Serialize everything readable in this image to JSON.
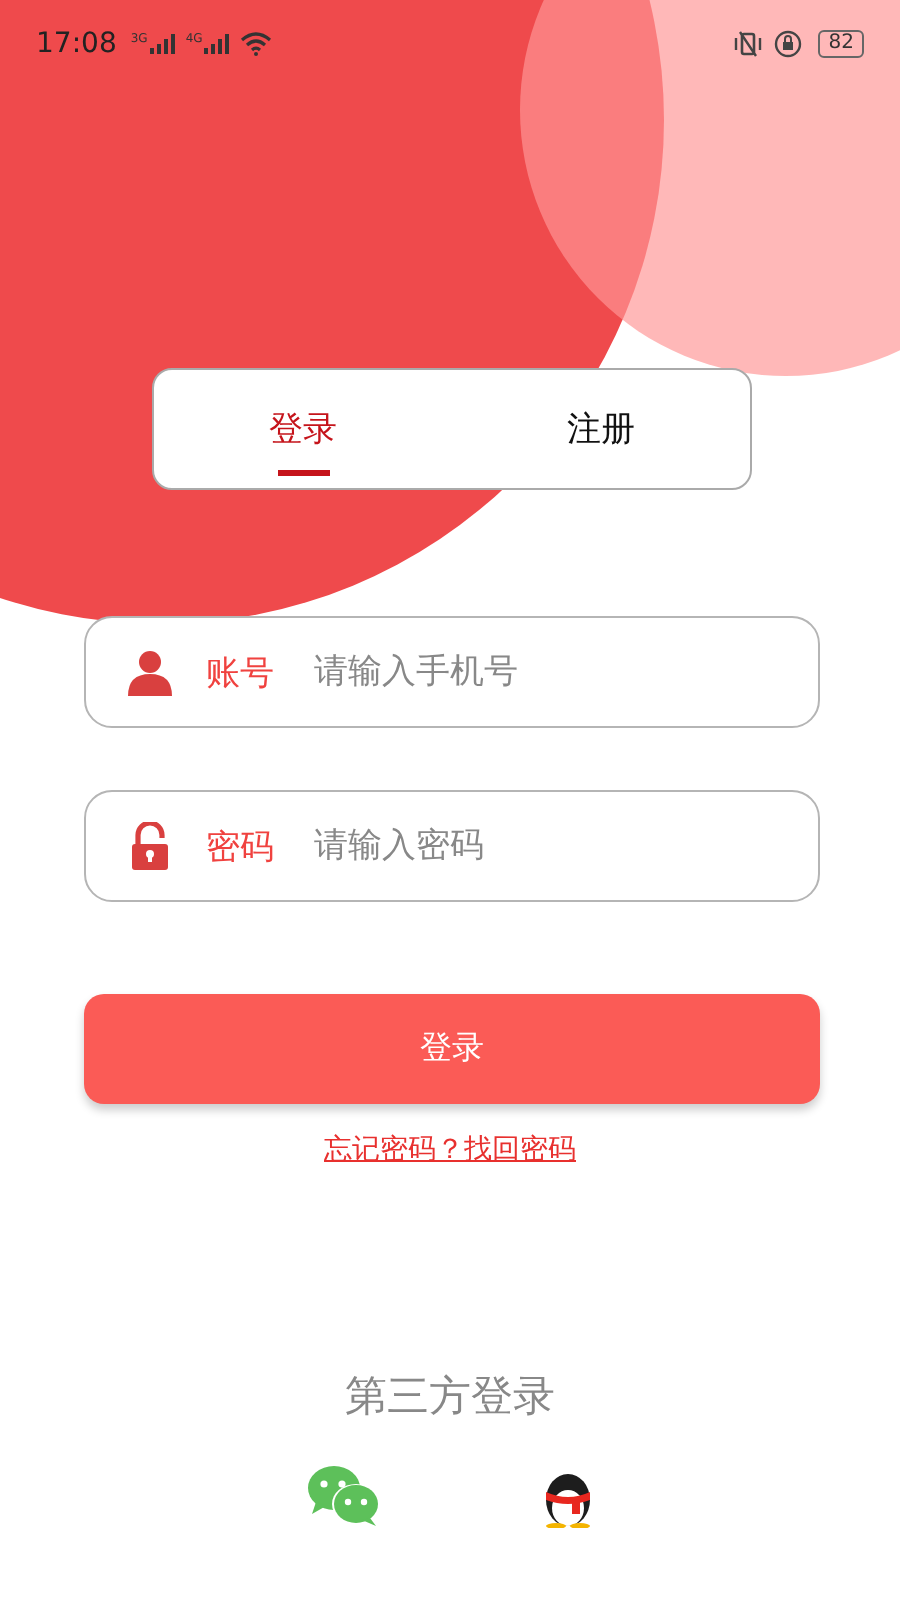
{
  "status_bar": {
    "time": "17:08",
    "network_labels": [
      "3G",
      "4G"
    ],
    "battery": "82"
  },
  "tabs": [
    {
      "label": "登录",
      "selected": true
    },
    {
      "label": "注册",
      "selected": false
    }
  ],
  "fields": [
    {
      "kind": "account",
      "label": "账号",
      "placeholder": "请输入手机号"
    },
    {
      "kind": "password",
      "label": "密码",
      "placeholder": "请输入密码"
    }
  ],
  "login_button": "登录",
  "forgot_link": "忘记密码？找回密码",
  "third_party": {
    "title": "第三方登录",
    "providers": [
      {
        "kind": "wechat"
      },
      {
        "kind": "qq"
      }
    ]
  }
}
